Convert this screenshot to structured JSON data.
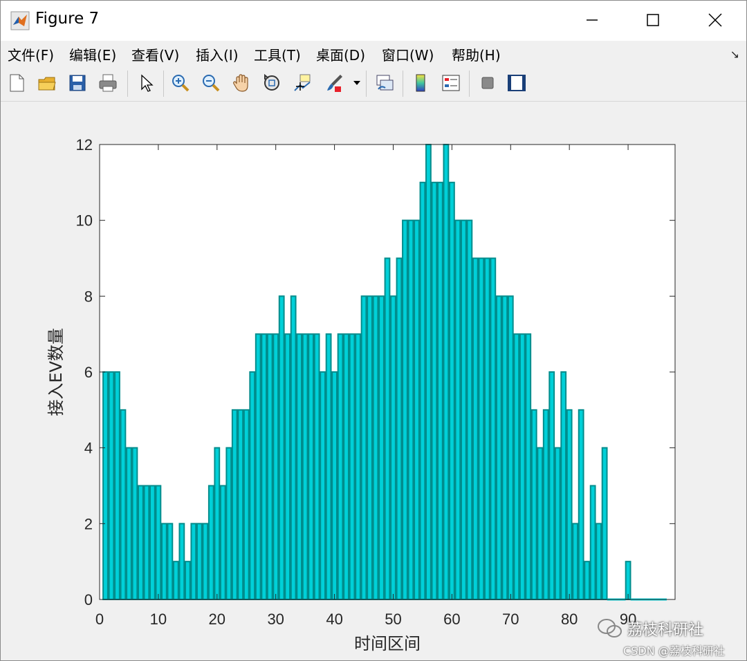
{
  "window": {
    "title": "Figure 7",
    "minimize_label": "Minimize",
    "maximize_label": "Maximize",
    "close_label": "Close"
  },
  "menu": {
    "items": [
      "文件(F)",
      "编辑(E)",
      "查看(V)",
      "插入(I)",
      "工具(T)",
      "桌面(D)",
      "窗口(W)",
      "帮助(H)"
    ]
  },
  "toolbar": {
    "icons": [
      "new-figure-icon",
      "open-file-icon",
      "save-icon",
      "print-icon",
      "pointer-icon",
      "zoom-in-icon",
      "zoom-out-icon",
      "pan-hand-icon",
      "rotate-3d-icon",
      "data-cursor-icon",
      "brush-icon",
      "link-plot-icon",
      "colorbar-icon",
      "legend-icon",
      "hide-plot-tools-icon",
      "show-plot-tools-icon"
    ]
  },
  "colors": {
    "bar_fill": "#00d0d8",
    "bar_edge": "#008c8c",
    "axes_bg": "#ffffff",
    "figure_bg": "#f0f0f0"
  },
  "chart_data": {
    "type": "bar",
    "xlabel": "时间区间",
    "ylabel": "接入EV数量",
    "title": "",
    "xlim": [
      0,
      98
    ],
    "ylim": [
      0,
      12
    ],
    "xticks": [
      0,
      10,
      20,
      30,
      40,
      50,
      60,
      70,
      80,
      90
    ],
    "yticks": [
      0,
      2,
      4,
      6,
      8,
      10,
      12
    ],
    "grid": false,
    "x": [
      1,
      2,
      3,
      4,
      5,
      6,
      7,
      8,
      9,
      10,
      11,
      12,
      13,
      14,
      15,
      16,
      17,
      18,
      19,
      20,
      21,
      22,
      23,
      24,
      25,
      26,
      27,
      28,
      29,
      30,
      31,
      32,
      33,
      34,
      35,
      36,
      37,
      38,
      39,
      40,
      41,
      42,
      43,
      44,
      45,
      46,
      47,
      48,
      49,
      50,
      51,
      52,
      53,
      54,
      55,
      56,
      57,
      58,
      59,
      60,
      61,
      62,
      63,
      64,
      65,
      66,
      67,
      68,
      69,
      70,
      71,
      72,
      73,
      74,
      75,
      76,
      77,
      78,
      79,
      80,
      81,
      82,
      83,
      84,
      85,
      86,
      87,
      88,
      89,
      90,
      91,
      92,
      93,
      94,
      95,
      96
    ],
    "values": [
      6,
      6,
      6,
      5,
      4,
      4,
      3,
      3,
      3,
      3,
      2,
      2,
      1,
      2,
      1,
      2,
      2,
      2,
      3,
      4,
      3,
      4,
      5,
      5,
      5,
      6,
      7,
      7,
      7,
      7,
      8,
      7,
      8,
      7,
      7,
      7,
      7,
      6,
      7,
      6,
      7,
      7,
      7,
      7,
      8,
      8,
      8,
      8,
      9,
      8,
      9,
      10,
      10,
      10,
      11,
      12,
      11,
      11,
      12,
      11,
      10,
      10,
      10,
      9,
      9,
      9,
      9,
      8,
      8,
      8,
      7,
      7,
      7,
      5,
      4,
      5,
      6,
      4,
      6,
      5,
      2,
      5,
      1,
      3,
      2,
      4,
      0,
      0,
      0,
      1,
      0,
      0,
      0,
      0,
      0,
      0
    ]
  },
  "watermark": {
    "brand": "荔枝科研社",
    "csdn": "CSDN @荔枝科研社"
  }
}
